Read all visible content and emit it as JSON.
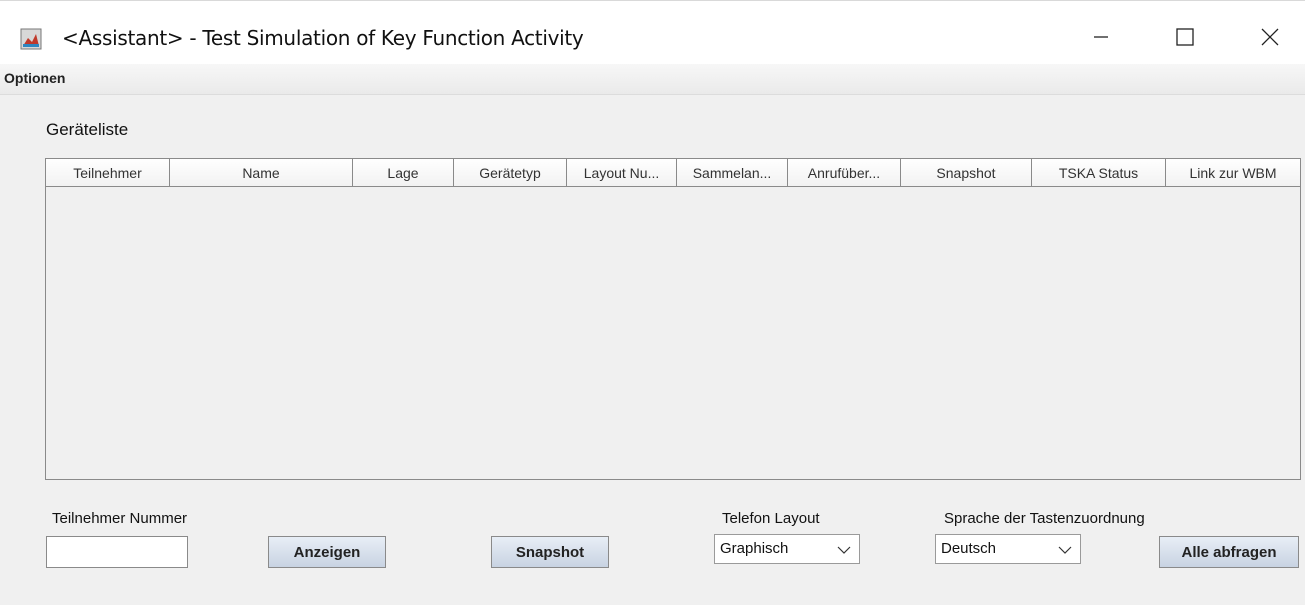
{
  "window": {
    "title": "<Assistant> - Test Simulation of Key Function Activity",
    "icons": [
      "app-icon",
      "minimize-icon",
      "maximize-icon",
      "close-icon"
    ]
  },
  "menu": {
    "items": [
      {
        "label": "Optionen"
      }
    ]
  },
  "section": {
    "title": "Geräteliste"
  },
  "table": {
    "columns": [
      "Teilnehmer",
      "Name",
      "Lage",
      "Gerätetyp",
      "Layout Nu...",
      "Sammelan...",
      "Anrufüber...",
      "Snapshot",
      "TSKA Status",
      "Link zur WBM"
    ]
  },
  "controls": {
    "teilnehmer_label": "Teilnehmer Nummer",
    "teilnehmer_value": "",
    "anzeigen": "Anzeigen",
    "snapshot": "Snapshot",
    "layout_label": "Telefon Layout",
    "layout_value": "Graphisch",
    "sprache_label": "Sprache der Tastenzuordnung",
    "sprache_value": "Deutsch",
    "alle": "Alle abfragen"
  }
}
